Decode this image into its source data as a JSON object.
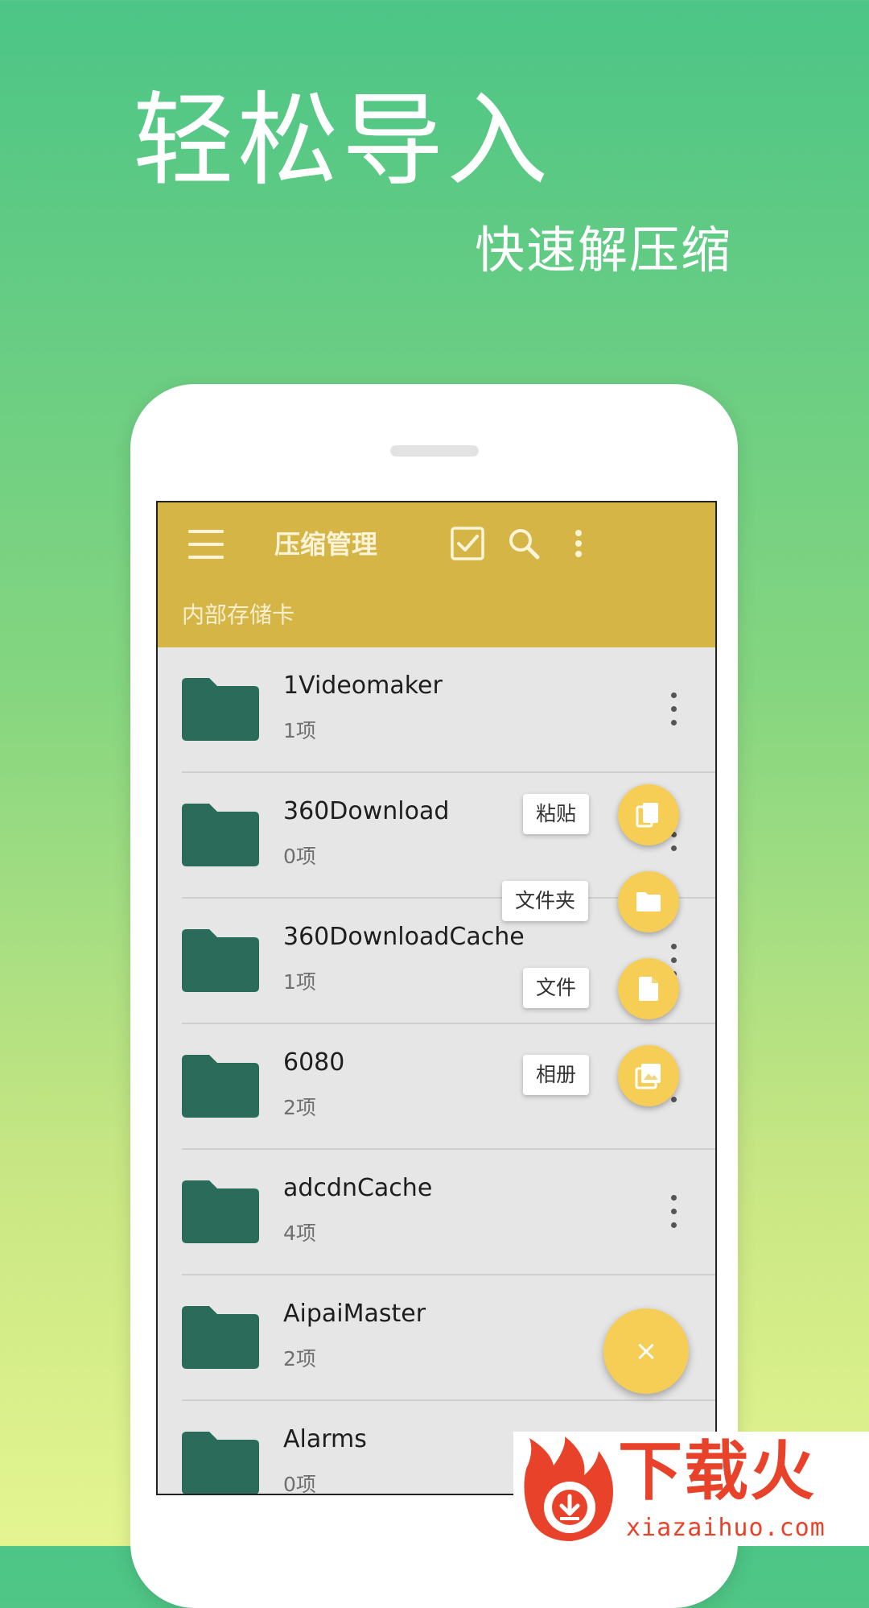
{
  "promo": {
    "headline": "轻松导入",
    "subheadline": "快速解压缩"
  },
  "app": {
    "title": "压缩管理",
    "path": "内部存储卡",
    "toolbar_icons": [
      "checkbox-icon",
      "search-icon",
      "more-vert-icon"
    ]
  },
  "files": [
    {
      "name": "1Videomaker",
      "count": "1项"
    },
    {
      "name": "360Download",
      "count": "0项"
    },
    {
      "name": "360DownloadCache",
      "count": "1项"
    },
    {
      "name": "6080",
      "count": "2项"
    },
    {
      "name": "adcdnCache",
      "count": "4项"
    },
    {
      "name": "AipaiMaster",
      "count": "2项"
    },
    {
      "name": "Alarms",
      "count": "0项"
    }
  ],
  "fab_menu": {
    "items": [
      {
        "label": "粘贴",
        "icon": "paste-icon"
      },
      {
        "label": "文件夹",
        "icon": "folder-icon"
      },
      {
        "label": "文件",
        "icon": "file-icon"
      },
      {
        "label": "相册",
        "icon": "album-icon"
      }
    ],
    "close_symbol": "×"
  },
  "watermark": {
    "brand": "下载火",
    "url": "xiazaihuo.com"
  },
  "colors": {
    "appbar": "#d5b546",
    "folder": "#2a6b5a",
    "fab": "#f6cd55",
    "brand_red": "#e8432a"
  }
}
